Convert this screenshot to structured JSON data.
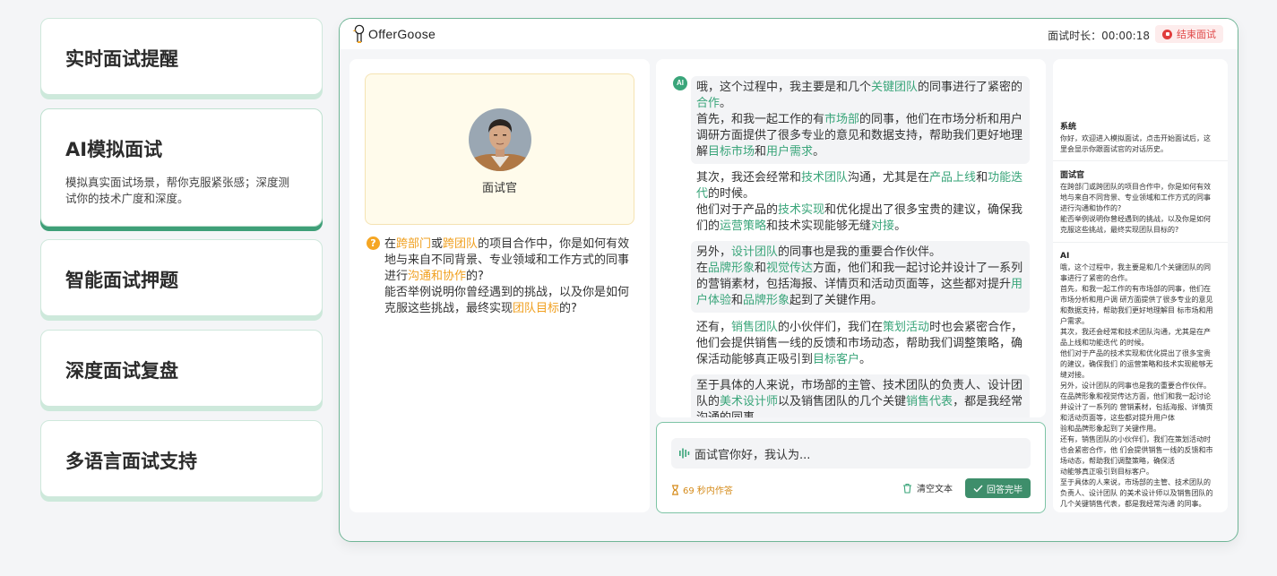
{
  "features": [
    {
      "title": "实时面试提醒",
      "desc": ""
    },
    {
      "title": "AI模拟面试",
      "desc": "模拟真实面试场景，帮你克服紧张感；深度测试你的技术广度和深度。"
    },
    {
      "title": "智能面试押题",
      "desc": ""
    },
    {
      "title": "深度面试复盘",
      "desc": ""
    },
    {
      "title": "多语言面试支持",
      "desc": ""
    }
  ],
  "app": {
    "brand": "OfferGoose",
    "timer_label": "面试时长：",
    "timer_value": "00:00:18",
    "end_button": "结束面试"
  },
  "interviewer": {
    "label": "面试官",
    "question_segments": [
      {
        "t": "在",
        "c": ""
      },
      {
        "t": "跨部门",
        "c": "o"
      },
      {
        "t": "或",
        "c": ""
      },
      {
        "t": "跨团队",
        "c": "o"
      },
      {
        "t": "的项目合作中，你是如何有效地与来自不同背景、专业领域和工作方式的同事进行",
        "c": ""
      },
      {
        "t": "沟通和协作",
        "c": "o"
      },
      {
        "t": "的?",
        "c": ""
      },
      {
        "t": "\n能否举例说明你曾经遇到的挑战，以及你是如何克服这些挑战，最终实现",
        "c": ""
      },
      {
        "t": "团队目标",
        "c": "o"
      },
      {
        "t": "的?",
        "c": ""
      }
    ]
  },
  "conversation": {
    "ai_badge": "AI",
    "bubbles": [
      {
        "gray": true,
        "segments": [
          {
            "t": "哦，这个过程中，我主要是和几个",
            "c": ""
          },
          {
            "t": "关键团队",
            "c": "g"
          },
          {
            "t": "的同事进行了紧密的",
            "c": ""
          },
          {
            "t": "合作",
            "c": "g"
          },
          {
            "t": "。\n首先，和我一起工作的有",
            "c": ""
          },
          {
            "t": "市场部",
            "c": "g"
          },
          {
            "t": "的同事，他们在市场分析和用户调研方面提供了很多专业的意见和数据支持，帮助我们更好地理解",
            "c": ""
          },
          {
            "t": "目标市场",
            "c": "g"
          },
          {
            "t": "和",
            "c": ""
          },
          {
            "t": "用户需求",
            "c": "g"
          },
          {
            "t": "。",
            "c": ""
          }
        ]
      },
      {
        "gray": false,
        "segments": [
          {
            "t": "其次，我还会经常和",
            "c": ""
          },
          {
            "t": "技术团队",
            "c": "g"
          },
          {
            "t": "沟通，尤其是在",
            "c": ""
          },
          {
            "t": "产品上线",
            "c": "g"
          },
          {
            "t": "和",
            "c": ""
          },
          {
            "t": "功能迭代",
            "c": "g"
          },
          {
            "t": "的时候。\n他们对于产品的",
            "c": ""
          },
          {
            "t": "技术实现",
            "c": "g"
          },
          {
            "t": "和优化提出了很多宝贵的建议，确保我们的",
            "c": ""
          },
          {
            "t": "运营策略",
            "c": "g"
          },
          {
            "t": "和技术实现能够无缝",
            "c": ""
          },
          {
            "t": "对接",
            "c": "g"
          },
          {
            "t": "。",
            "c": ""
          }
        ]
      },
      {
        "gray": true,
        "segments": [
          {
            "t": "另外，",
            "c": ""
          },
          {
            "t": "设计团队",
            "c": "g"
          },
          {
            "t": "的同事也是我的重要合作伙伴。\n在",
            "c": ""
          },
          {
            "t": "品牌形象",
            "c": "g"
          },
          {
            "t": "和",
            "c": ""
          },
          {
            "t": "视觉传达",
            "c": "g"
          },
          {
            "t": "方面，他们和我一起讨论并设计了一系列的营销素材，包括海报、详情页和活动页面等，这些都对提升",
            "c": ""
          },
          {
            "t": "用户体验",
            "c": "g"
          },
          {
            "t": "和",
            "c": ""
          },
          {
            "t": "品牌形象",
            "c": "g"
          },
          {
            "t": "起到了关键作用。",
            "c": ""
          }
        ]
      },
      {
        "gray": false,
        "segments": [
          {
            "t": "还有，",
            "c": ""
          },
          {
            "t": "销售团队",
            "c": "g"
          },
          {
            "t": "的小伙伴们，我们在",
            "c": ""
          },
          {
            "t": "策划活动",
            "c": "g"
          },
          {
            "t": "时也会紧密合作，他们会提供销售一线的反馈和市场动态，帮助我们调整策略，确保活动能够真正吸引到",
            "c": ""
          },
          {
            "t": "目标客户",
            "c": "g"
          },
          {
            "t": "。",
            "c": ""
          }
        ]
      },
      {
        "gray": true,
        "segments": [
          {
            "t": "至于具体的人来说，市场部的主管、技术团队的负责人、设计团队的",
            "c": ""
          },
          {
            "t": "美术设计师",
            "c": "g"
          },
          {
            "t": "以及销售团队的几个关键",
            "c": ""
          },
          {
            "t": "销售代表",
            "c": "g"
          },
          {
            "t": "，都是我经常沟通的同事。",
            "c": ""
          }
        ]
      }
    ]
  },
  "answer": {
    "input_text": "面试官你好，我认为...",
    "countdown": "69 秒内作答",
    "clear_label": "清空文本",
    "done_label": "回答完毕"
  },
  "transcript": {
    "system_title": "系统",
    "system_lines": [
      "你好，欢迎进入模拟面试，点击开始面试后，这",
      "里会显示你跟面试官的对话历史。"
    ],
    "interviewer_title": "面试官",
    "interviewer_lines": [
      "在跨部门或跨团队的项目合作中，你是如何有效",
      "地与来自不同背景、专业领域和工作方式的同事",
      "进行沟通和协作的?",
      "能否举例说明你曾经遇到的挑战，以及你是如何",
      "克服这些挑战，最终实现团队目标的?"
    ],
    "ai_title": "AI",
    "ai_lines": [
      "哦，这个过程中，我主要是和几个关键团队的同",
      "事进行了紧密的合作。",
      "首先，和我一起工作的有市场部的同事，他们在",
      "市场分析和用户调 研方面提供了很多专业的意见",
      "和数据支持，帮助我们更好地理解目 标市场和用",
      "户需求。",
      "其次，我还会经常和技术团队沟通，尤其是在产",
      "品上线和功能迭代 的时候。",
      "他们对于产品的技术实现和优化提出了很多宝贵",
      "的建议，确保我们 的运营策略和技术实现能够无",
      "缝对接。",
      "另外，设计团队的同事也是我的重要合作伙伴。",
      "在品牌形象和视觉传达方面，他们和我一起讨论",
      "并设计了一系列的 营销素材，包括海报、详情页",
      "和活动页面等，这些都对提升用户体",
      "验和品牌形象起到了关键作用。",
      "还有，销售团队的小伙伴们，我们在策划活动时",
      "也会紧密合作，他 们会提供销售一线的反馈和市",
      "场动态，帮助我们调整策略，确保活",
      "动能够真正吸引到目标客户。",
      "至于具体的人来说，市场部的主管、技术团队的",
      "负责人、设计团队 的美术设计师以及销售团队的",
      "几个关键销售代表，都是我经常沟通 的同事。"
    ]
  },
  "colors": {
    "accent_green": "#3aa57a",
    "highlight_orange": "#f0a020",
    "end_red": "#e03c3c"
  }
}
